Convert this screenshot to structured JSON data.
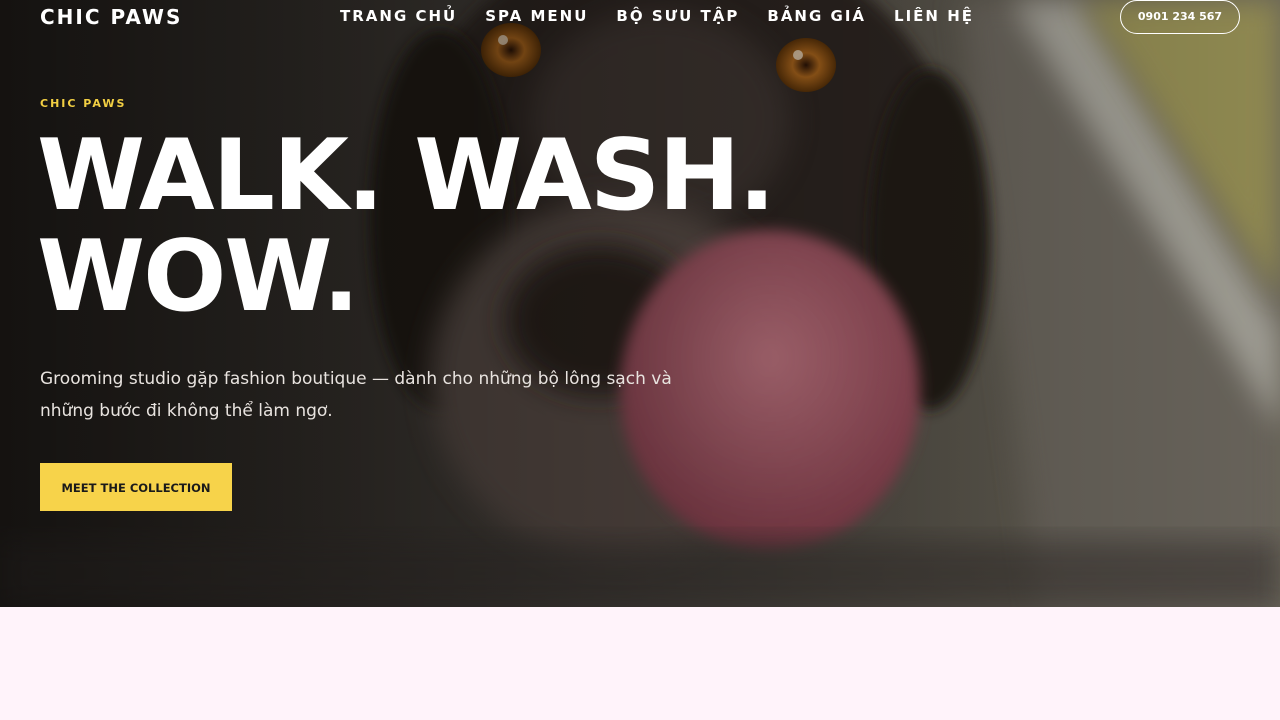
{
  "brand": {
    "logo": "CHIC PAWS"
  },
  "nav": {
    "items": [
      {
        "label": "TRANG CHỦ"
      },
      {
        "label": "SPA MENU"
      },
      {
        "label": "BỘ SƯU TẬP"
      },
      {
        "label": "BẢNG GIÁ"
      },
      {
        "label": "LIÊN HỆ"
      }
    ],
    "phone": "0901 234 567"
  },
  "hero": {
    "eyebrow": "CHIC PAWS",
    "headline_line1": "WALK. WASH.",
    "headline_line2": "WOW.",
    "tagline": "Grooming studio gặp fashion boutique — dành cho những bộ lông sạch và những bước đi không thể làm ngơ.",
    "cta_label": "MEET THE COLLECTION"
  },
  "colors": {
    "accent": "#f7d34a",
    "eyebrow": "#f2cf43",
    "page_background": "#fff3fa",
    "text_light": "#ffffff"
  }
}
